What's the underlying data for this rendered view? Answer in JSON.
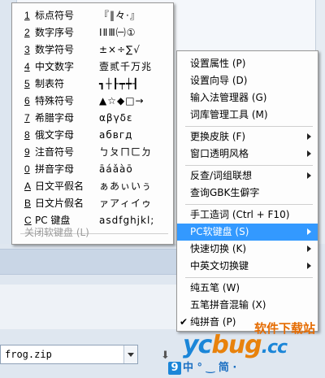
{
  "soft_keyboard_menu": {
    "items": [
      {
        "num": "1",
        "label": "标点符号",
        "sample": "『‖々·』"
      },
      {
        "num": "2",
        "label": "数字序号",
        "sample": "ⅠⅡⅢ㈠①"
      },
      {
        "num": "3",
        "label": "数学符号",
        "sample": "±×÷∑√"
      },
      {
        "num": "4",
        "label": "中文数字",
        "sample": "壹贰千万兆"
      },
      {
        "num": "5",
        "label": "制表符",
        "sample": "┓┼┠┯┿┨"
      },
      {
        "num": "6",
        "label": "特殊符号",
        "sample": "▲☆◆□→"
      },
      {
        "num": "7",
        "label": "希腊字母",
        "sample": "αβγδε"
      },
      {
        "num": "8",
        "label": "俄文字母",
        "sample": "абвгд"
      },
      {
        "num": "9",
        "label": "注音符号",
        "sample": "ㄅㄆㄇㄈㄉ"
      },
      {
        "num": "0",
        "label": "拼音字母",
        "sample": "āáǎàō"
      },
      {
        "num": "A",
        "label": "日文平假名",
        "sample": "ぁあぃいぅ"
      },
      {
        "num": "B",
        "label": "日文片假名",
        "sample": "ァアィイゥ"
      },
      {
        "num": "C",
        "label": "PC 键盘",
        "sample": "asdfghjkl;"
      }
    ],
    "close_label": "关闭软键盘 (L)"
  },
  "ime_menu": {
    "group1": [
      "设置属性 (P)",
      "设置向导 (D)",
      "输入法管理器 (G)",
      "词库管理工具 (M)"
    ],
    "group2": [
      "更换皮肤 (F)",
      "窗口透明风格"
    ],
    "group3": [
      "反查/词组联想",
      "查询GBK生僻字"
    ],
    "group4": [
      "手工造词 (Ctrl + F10)",
      "PC软键盘 (S)",
      "快速切换 (K)",
      "中英文切换键"
    ],
    "group5": [
      "纯五笔 (W)",
      "五笔拼音混输 (X)",
      "纯拼音 (P)"
    ]
  },
  "file_field": {
    "value": "frog.zip"
  },
  "watermark": {
    "cn": "软件下载站",
    "logo1": "yc",
    "logo2": "bug",
    "logo3": ".cc",
    "sub_nine": "9",
    "sub_text": "中 ° ‿ 简 ·"
  }
}
